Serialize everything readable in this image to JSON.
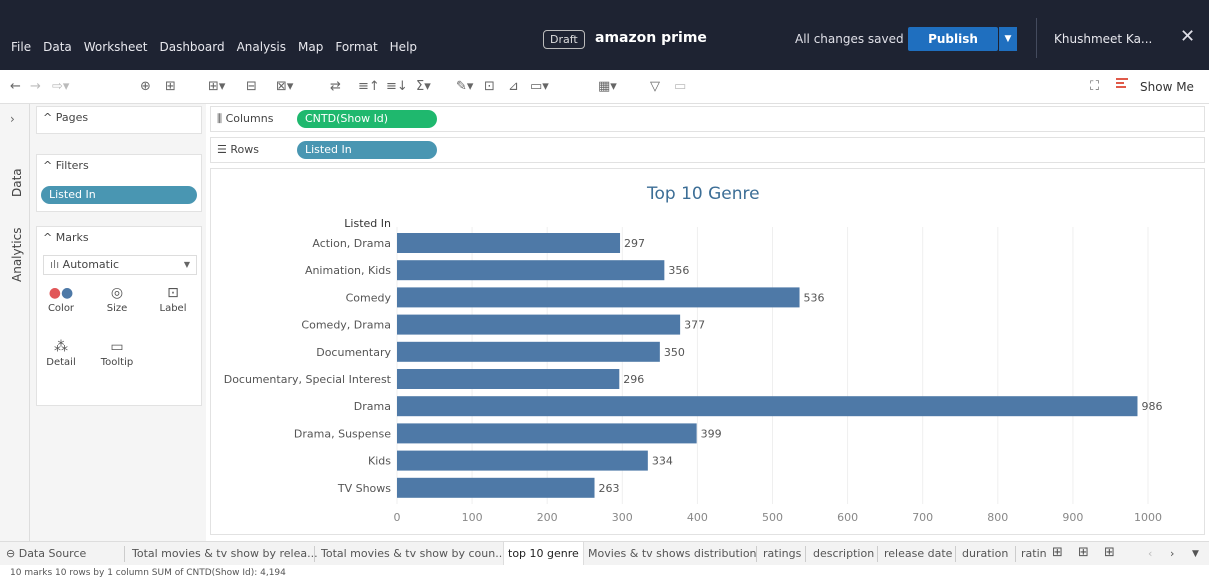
{
  "menubar": {
    "menus": [
      "File",
      "Data",
      "Worksheet",
      "Dashboard",
      "Analysis",
      "Map",
      "Format",
      "Help"
    ],
    "draft": "Draft",
    "title": "amazon prime",
    "saved": "All changes saved",
    "publish": "Publish",
    "user": "Khushmeet Ka...",
    "close": "✕"
  },
  "toolbar": {
    "show_me": "Show Me"
  },
  "side": {
    "data_tab": "Data",
    "analytics_tab": "Analytics"
  },
  "cards": {
    "pages": "^ Pages",
    "filters": "^ Filters",
    "filter_pill": "Listed In",
    "marks": "^ Marks",
    "marks_type": "Automatic",
    "color": "Color",
    "size": "Size",
    "label": "Label",
    "detail": "Detail",
    "tooltip": "Tooltip"
  },
  "shelves": {
    "columns_label": "Columns",
    "columns_pill": "CNTD(Show Id)",
    "rows_label": "Rows",
    "rows_pill": "Listed In"
  },
  "chart_data": {
    "type": "bar",
    "orientation": "horizontal",
    "title": "Top 10 Genre",
    "row_header": "Listed In",
    "categories": [
      "Action, Drama",
      "Animation, Kids",
      "Comedy",
      "Comedy, Drama",
      "Documentary",
      "Documentary, Special Interest",
      "Drama",
      "Drama, Suspense",
      "Kids",
      "TV Shows"
    ],
    "values": [
      297,
      356,
      536,
      377,
      350,
      296,
      986,
      399,
      334,
      263
    ],
    "xlim": [
      0,
      1000
    ],
    "xticks": [
      0,
      100,
      200,
      300,
      400,
      500,
      600,
      700,
      800,
      900,
      1000
    ],
    "bar_color": "#4e79a7",
    "grid": true
  },
  "tabs": {
    "data_source": "Data Source",
    "items": [
      "Total movies & tv show by relea...",
      "Total movies & tv show by coun...",
      "top 10 genre",
      "Movies & tv shows distribution",
      "ratings",
      "description",
      "release date",
      "duration",
      "ratin"
    ],
    "active": "top 10 genre"
  },
  "status": "10 marks   10 rows by 1 column   SUM of CNTD(Show Id): 4,194",
  "colors": {
    "header_bg": "#1e2332",
    "publish": "#1f6fbf",
    "pill_blue": "#4996b2",
    "pill_green": "#1fb86e"
  }
}
